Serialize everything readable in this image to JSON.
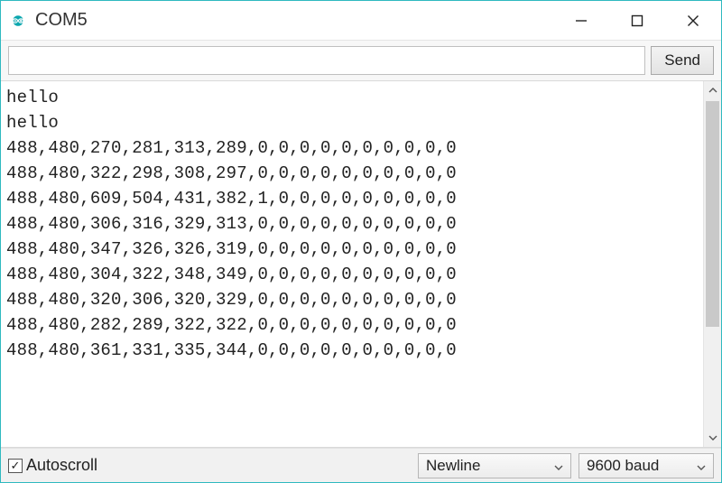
{
  "window": {
    "title": "COM5"
  },
  "send": {
    "input_value": "",
    "input_placeholder": "",
    "button_label": "Send"
  },
  "console": {
    "lines": [
      "hello",
      "hello",
      "488,480,270,281,313,289,0,0,0,0,0,0,0,0,0,0",
      "488,480,322,298,308,297,0,0,0,0,0,0,0,0,0,0",
      "488,480,609,504,431,382,1,0,0,0,0,0,0,0,0,0",
      "488,480,306,316,329,313,0,0,0,0,0,0,0,0,0,0",
      "488,480,347,326,326,319,0,0,0,0,0,0,0,0,0,0",
      "488,480,304,322,348,349,0,0,0,0,0,0,0,0,0,0",
      "488,480,320,306,320,329,0,0,0,0,0,0,0,0,0,0",
      "488,480,282,289,322,322,0,0,0,0,0,0,0,0,0,0",
      "488,480,361,331,335,344,0,0,0,0,0,0,0,0,0,0"
    ]
  },
  "bottom": {
    "autoscroll_label": "Autoscroll",
    "autoscroll_checked": true,
    "line_ending_selected": "Newline",
    "baud_selected": "9600 baud"
  },
  "icons": {
    "logo": "arduino-logo-icon",
    "minimize": "minimize-icon",
    "maximize": "maximize-icon",
    "close": "close-icon"
  },
  "colors": {
    "border": "#2fb9c0",
    "arduino_teal": "#0aa6ae"
  }
}
